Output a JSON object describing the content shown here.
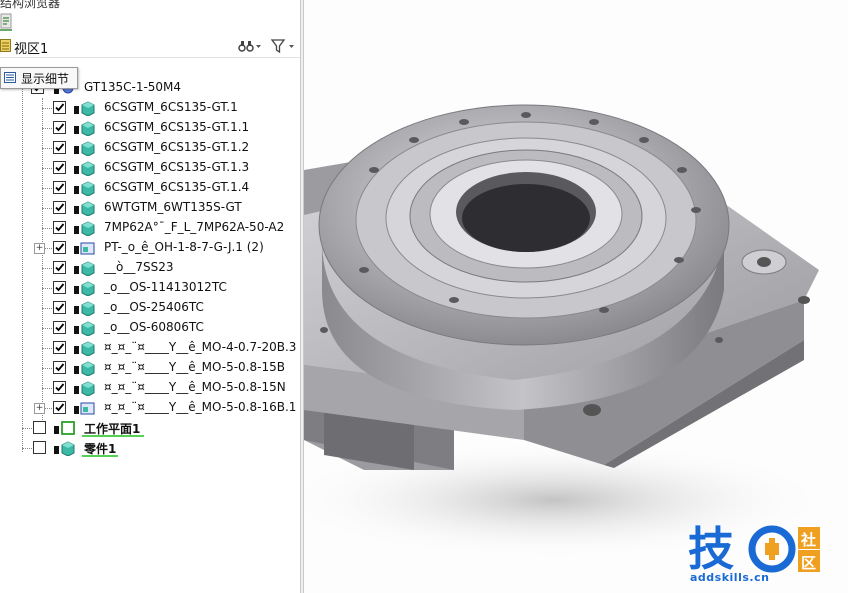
{
  "panel": {
    "title_partial": "结构浏览器",
    "view_label": "视区1",
    "tooltip": "显示细节"
  },
  "tree": {
    "root": "GT135C-1-50M4",
    "items": [
      {
        "label": "6CSGTM_6CS135-GT.1",
        "checked": true,
        "expander": false,
        "icon": "part"
      },
      {
        "label": "6CSGTM_6CS135-GT.1.1",
        "checked": true,
        "expander": false,
        "icon": "part"
      },
      {
        "label": "6CSGTM_6CS135-GT.1.2",
        "checked": true,
        "expander": false,
        "icon": "part"
      },
      {
        "label": "6CSGTM_6CS135-GT.1.3",
        "checked": true,
        "expander": false,
        "icon": "part"
      },
      {
        "label": "6CSGTM_6CS135-GT.1.4",
        "checked": true,
        "expander": false,
        "icon": "part"
      },
      {
        "label": "6WTGTM_6WT135S-GT",
        "checked": true,
        "expander": false,
        "icon": "part"
      },
      {
        "label": "7MP62A°¯_F_L_7MP62A-50-A2",
        "checked": true,
        "expander": false,
        "icon": "part"
      },
      {
        "label": "PT-_o_ê_OH-1-8-7-G-J.1 (2)",
        "checked": true,
        "expander": true,
        "icon": "assembly"
      },
      {
        "label": "__ò__7SS23",
        "checked": true,
        "expander": false,
        "icon": "part"
      },
      {
        "label": "_o__OS-11413012TC",
        "checked": true,
        "expander": false,
        "icon": "part"
      },
      {
        "label": "_o__OS-25406TC",
        "checked": true,
        "expander": false,
        "icon": "part"
      },
      {
        "label": "_o__OS-60806TC",
        "checked": true,
        "expander": false,
        "icon": "part"
      },
      {
        "label": "¤_¤_¨¤____Y__ê_MO-4-0.7-20B.3",
        "checked": true,
        "expander": false,
        "icon": "part"
      },
      {
        "label": "¤_¤_¨¤____Y__ê_MO-5-0.8-15B",
        "checked": true,
        "expander": false,
        "icon": "part"
      },
      {
        "label": "¤_¤_¨¤____Y__ê_MO-5-0.8-15N",
        "checked": true,
        "expander": false,
        "icon": "part"
      },
      {
        "label": "¤_¤_¨¤____Y__ê_MO-5-0.8-16B.1 (",
        "checked": true,
        "expander": true,
        "icon": "assembly"
      }
    ],
    "extras": [
      {
        "label": "工作平面1",
        "checked": false,
        "icon": "workplane"
      },
      {
        "label": "零件1",
        "checked": false,
        "icon": "part"
      }
    ]
  },
  "watermark": {
    "char1": "技",
    "char2a": "社",
    "char2b": "区",
    "url": "addskills.cn"
  },
  "colors": {
    "part_icon": "#3cb8a6",
    "accent_green": "#55d155",
    "watermark_blue": "#1a6ad6",
    "metal": "#b8b8bc"
  }
}
